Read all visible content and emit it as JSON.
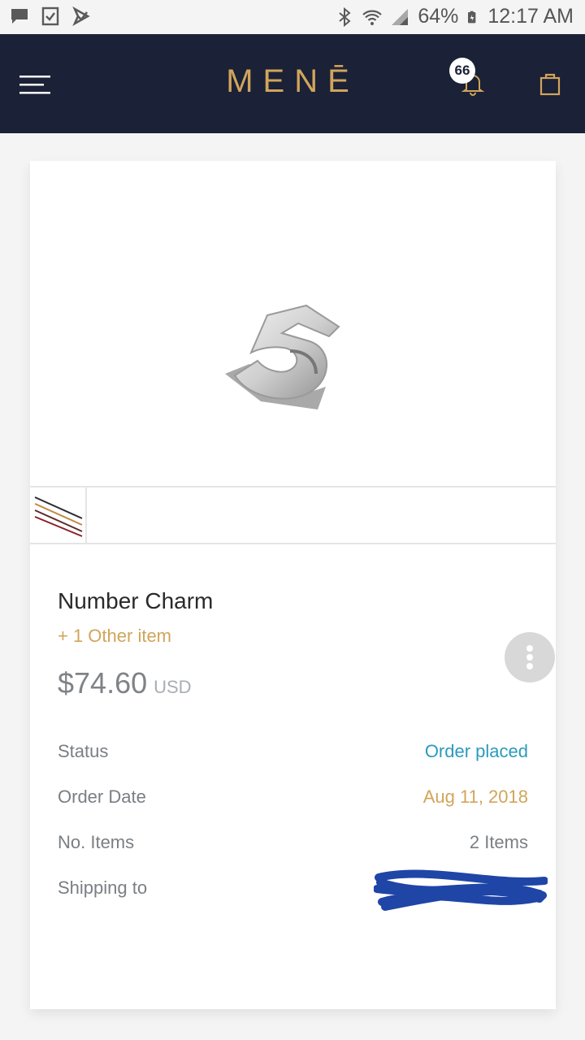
{
  "status_bar": {
    "battery": "64%",
    "time": "12:17 AM",
    "left_icons": [
      "message-icon",
      "checklist-icon",
      "task-icon"
    ],
    "right_icons": [
      "bluetooth-icon",
      "wifi-icon",
      "signal-icon",
      "battery-icon"
    ]
  },
  "header": {
    "brand": "MENĒ",
    "notification_count": "66",
    "icons": [
      "hamburger-menu-icon",
      "bell-icon",
      "shopping-bag-icon"
    ]
  },
  "order": {
    "product_name": "Number Charm",
    "other_items": "+ 1 Other item",
    "price": "$74.60",
    "currency": "USD",
    "details": {
      "status_label": "Status",
      "status_value": "Order placed",
      "date_label": "Order Date",
      "date_value": "Aug 11, 2018",
      "items_label": "No. Items",
      "items_value": "2 Items",
      "shipping_label": "Shipping to",
      "shipping_value": ""
    }
  },
  "colors": {
    "header_bg": "#1b2136",
    "brand_gold": "#d1a55b",
    "status_blue": "#2a9bbd",
    "text_gray": "#7a7f84"
  }
}
